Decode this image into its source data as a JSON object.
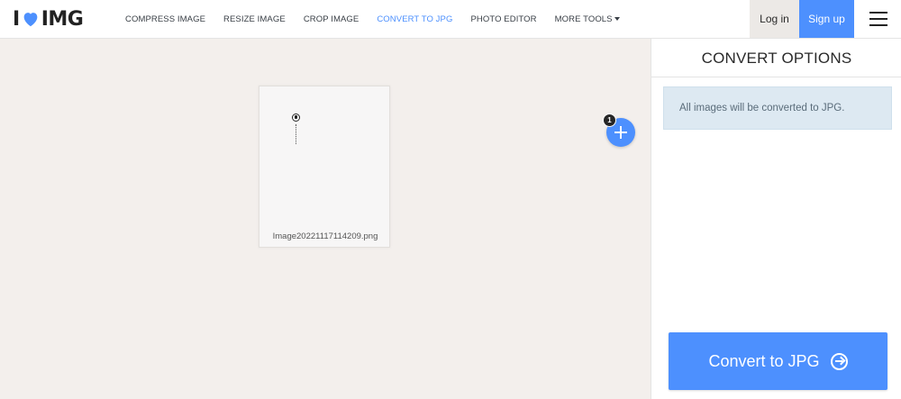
{
  "header": {
    "logo_left": "I",
    "logo_right": "IMG",
    "nav": [
      {
        "label": "COMPRESS IMAGE",
        "active": false
      },
      {
        "label": "RESIZE IMAGE",
        "active": false
      },
      {
        "label": "CROP IMAGE",
        "active": false
      },
      {
        "label": "CONVERT TO JPG",
        "active": true
      },
      {
        "label": "PHOTO EDITOR",
        "active": false
      },
      {
        "label": "MORE TOOLS",
        "active": false
      }
    ],
    "login_label": "Log in",
    "signup_label": "Sign up"
  },
  "workspace": {
    "file": {
      "name": "Image20221117114209.png"
    },
    "file_count": "1"
  },
  "sidebar": {
    "title": "CONVERT OPTIONS",
    "info": "All images will be converted to JPG.",
    "convert_label": "Convert to JPG"
  },
  "colors": {
    "accent": "#4d90fe",
    "workspace_bg": "#f3efec",
    "info_bg": "#dde9f2"
  },
  "icons": [
    "heart-logo-icon",
    "caret-down-icon",
    "hamburger-menu-icon",
    "plus-icon",
    "arrow-right-circle-icon"
  ]
}
